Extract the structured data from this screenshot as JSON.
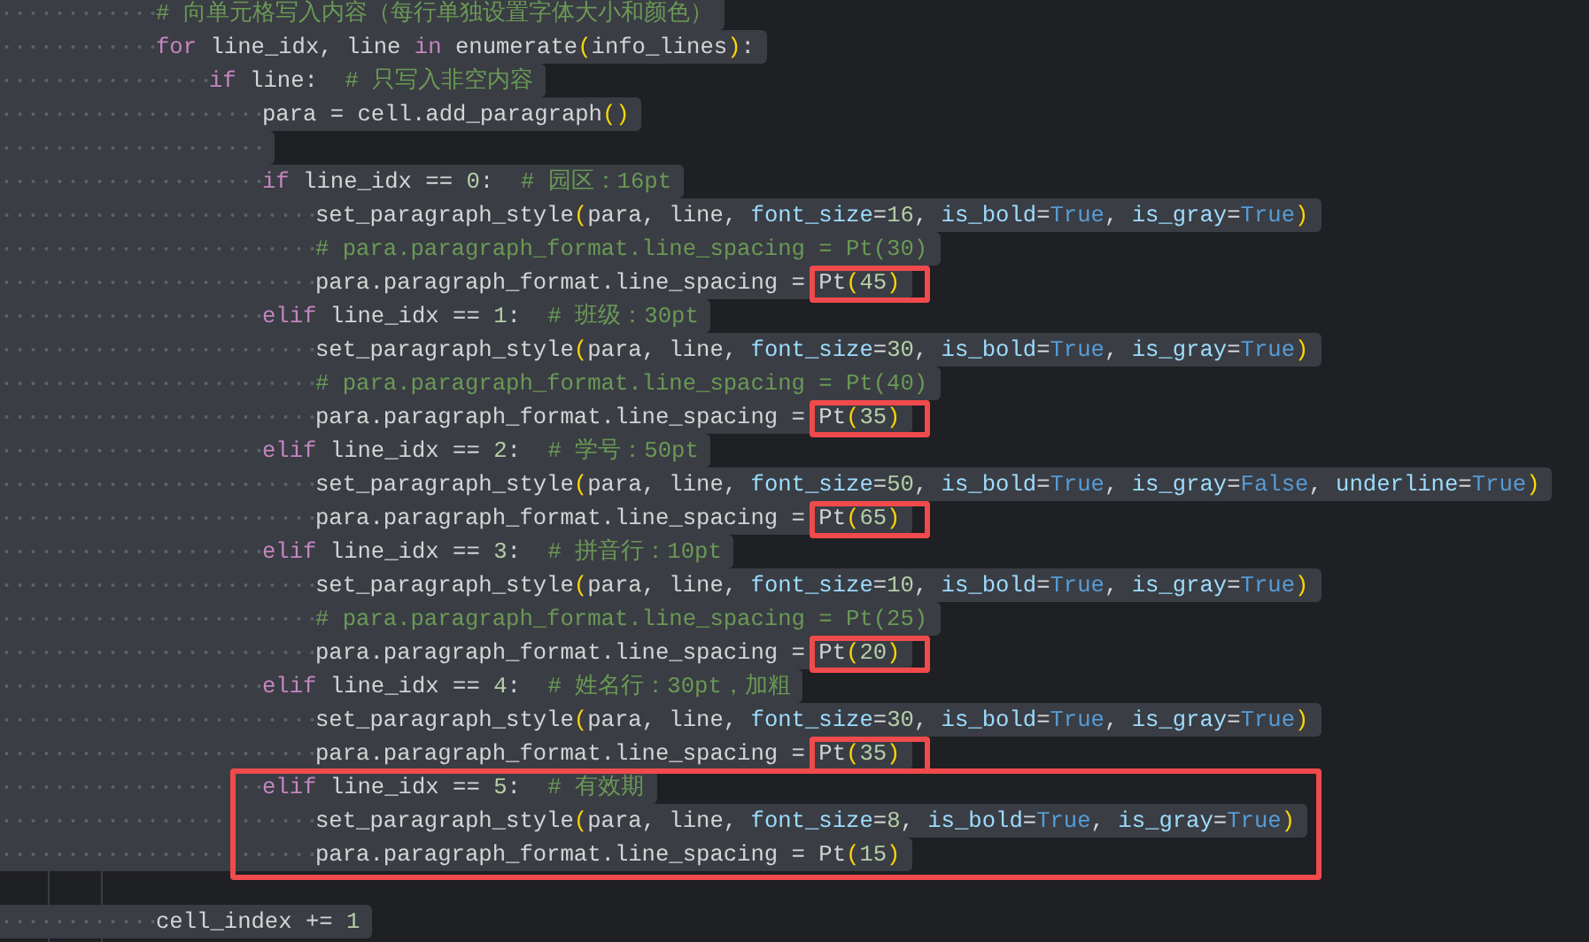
{
  "lines": [
    {
      "selected": true,
      "tokens": [
        {
          "kind": "cmt",
          "text": "# 向单元格写入内容（每行单独设置字体大小和颜色）"
        }
      ]
    },
    {
      "selected": true,
      "tokens": [
        {
          "kind": "kw",
          "text": "for"
        },
        {
          "kind": "id",
          "text": " line_idx, line "
        },
        {
          "kind": "kw",
          "text": "in"
        },
        {
          "kind": "id",
          "text": " enumerate"
        },
        {
          "kind": "paren",
          "text": "("
        },
        {
          "kind": "id",
          "text": "info_lines"
        },
        {
          "kind": "paren",
          "text": ")"
        },
        {
          "kind": "id",
          "text": ":"
        }
      ],
      "children": [
        {
          "selected": true,
          "tokens": [
            {
              "kind": "kw",
              "text": "if"
            },
            {
              "kind": "id",
              "text": " line:  "
            },
            {
              "kind": "cmt",
              "text": "# 只写入非空内容"
            }
          ],
          "children": [
            {
              "selected": true,
              "tokens": [
                {
                  "kind": "id",
                  "text": "para = cell.add_paragraph"
                },
                {
                  "kind": "paren",
                  "text": "()"
                }
              ]
            },
            {
              "selected": true
            },
            {
              "selected": true,
              "tokens": [
                {
                  "kind": "kw",
                  "text": "if"
                },
                {
                  "kind": "id",
                  "text": " line_idx == "
                },
                {
                  "kind": "num",
                  "text": "0"
                },
                {
                  "kind": "id",
                  "text": ":  "
                },
                {
                  "kind": "cmt",
                  "text": "# 园区：16pt"
                }
              ],
              "children": [
                {
                  "selected": true,
                  "tokens": [
                    {
                      "kind": "id",
                      "text": "set_paragraph_style"
                    },
                    {
                      "kind": "paren",
                      "text": "("
                    },
                    {
                      "kind": "id",
                      "text": "para, line, "
                    },
                    {
                      "kind": "param",
                      "text": "font_size"
                    },
                    {
                      "kind": "id",
                      "text": "="
                    },
                    {
                      "kind": "num",
                      "text": "16"
                    },
                    {
                      "kind": "id",
                      "text": ", "
                    },
                    {
                      "kind": "param",
                      "text": "is_bold"
                    },
                    {
                      "kind": "id",
                      "text": "="
                    },
                    {
                      "kind": "const",
                      "text": "True"
                    },
                    {
                      "kind": "id",
                      "text": ", "
                    },
                    {
                      "kind": "param",
                      "text": "is_gray"
                    },
                    {
                      "kind": "id",
                      "text": "="
                    },
                    {
                      "kind": "const",
                      "text": "True"
                    },
                    {
                      "kind": "paren",
                      "text": ")"
                    }
                  ]
                },
                {
                  "selected": true,
                  "tokens": [
                    {
                      "kind": "cmt",
                      "text": "# para.paragraph_format.line_spacing = Pt(30)"
                    }
                  ]
                },
                {
                  "selected": true,
                  "tokens": [
                    {
                      "kind": "id",
                      "text": "para.paragraph_format.line_spacing = "
                    },
                    {
                      "kind": "group",
                      "framed": true,
                      "tokens": [
                        {
                          "kind": "id",
                          "text": "Pt"
                        },
                        {
                          "kind": "paren",
                          "text": "("
                        },
                        {
                          "kind": "num",
                          "text": "45"
                        },
                        {
                          "kind": "paren",
                          "text": ")"
                        }
                      ]
                    }
                  ]
                }
              ]
            },
            {
              "selected": true,
              "tokens": [
                {
                  "kind": "kw",
                  "text": "elif"
                },
                {
                  "kind": "id",
                  "text": " line_idx == "
                },
                {
                  "kind": "num",
                  "text": "1"
                },
                {
                  "kind": "id",
                  "text": ":  "
                },
                {
                  "kind": "cmt",
                  "text": "# 班级：30pt"
                }
              ],
              "children": [
                {
                  "selected": true,
                  "tokens": [
                    {
                      "kind": "id",
                      "text": "set_paragraph_style"
                    },
                    {
                      "kind": "paren",
                      "text": "("
                    },
                    {
                      "kind": "id",
                      "text": "para, line, "
                    },
                    {
                      "kind": "param",
                      "text": "font_size"
                    },
                    {
                      "kind": "id",
                      "text": "="
                    },
                    {
                      "kind": "num",
                      "text": "30"
                    },
                    {
                      "kind": "id",
                      "text": ", "
                    },
                    {
                      "kind": "param",
                      "text": "is_bold"
                    },
                    {
                      "kind": "id",
                      "text": "="
                    },
                    {
                      "kind": "const",
                      "text": "True"
                    },
                    {
                      "kind": "id",
                      "text": ", "
                    },
                    {
                      "kind": "param",
                      "text": "is_gray"
                    },
                    {
                      "kind": "id",
                      "text": "="
                    },
                    {
                      "kind": "const",
                      "text": "True"
                    },
                    {
                      "kind": "paren",
                      "text": ")"
                    }
                  ]
                },
                {
                  "selected": true,
                  "tokens": [
                    {
                      "kind": "cmt",
                      "text": "# para.paragraph_format.line_spacing = Pt(40)"
                    }
                  ]
                },
                {
                  "selected": true,
                  "tokens": [
                    {
                      "kind": "id",
                      "text": "para.paragraph_format.line_spacing = "
                    },
                    {
                      "kind": "group",
                      "framed": true,
                      "tokens": [
                        {
                          "kind": "id",
                          "text": "Pt"
                        },
                        {
                          "kind": "paren",
                          "text": "("
                        },
                        {
                          "kind": "num",
                          "text": "35"
                        },
                        {
                          "kind": "paren",
                          "text": ")"
                        }
                      ]
                    }
                  ]
                }
              ]
            },
            {
              "selected": true,
              "tokens": [
                {
                  "kind": "kw",
                  "text": "elif"
                },
                {
                  "kind": "id",
                  "text": " line_idx == "
                },
                {
                  "kind": "num",
                  "text": "2"
                },
                {
                  "kind": "id",
                  "text": ":  "
                },
                {
                  "kind": "cmt",
                  "text": "# 学号：50pt"
                }
              ],
              "children": [
                {
                  "selected": true,
                  "tokens": [
                    {
                      "kind": "id",
                      "text": "set_paragraph_style"
                    },
                    {
                      "kind": "paren",
                      "text": "("
                    },
                    {
                      "kind": "id",
                      "text": "para, line, "
                    },
                    {
                      "kind": "param",
                      "text": "font_size"
                    },
                    {
                      "kind": "id",
                      "text": "="
                    },
                    {
                      "kind": "num",
                      "text": "50"
                    },
                    {
                      "kind": "id",
                      "text": ", "
                    },
                    {
                      "kind": "param",
                      "text": "is_bold"
                    },
                    {
                      "kind": "id",
                      "text": "="
                    },
                    {
                      "kind": "const",
                      "text": "True"
                    },
                    {
                      "kind": "id",
                      "text": ", "
                    },
                    {
                      "kind": "param",
                      "text": "is_gray"
                    },
                    {
                      "kind": "id",
                      "text": "="
                    },
                    {
                      "kind": "const",
                      "text": "False"
                    },
                    {
                      "kind": "id",
                      "text": ", "
                    },
                    {
                      "kind": "param",
                      "text": "underline"
                    },
                    {
                      "kind": "id",
                      "text": "="
                    },
                    {
                      "kind": "const",
                      "text": "True"
                    },
                    {
                      "kind": "paren",
                      "text": ")"
                    }
                  ]
                },
                {
                  "selected": true,
                  "tokens": [
                    {
                      "kind": "id",
                      "text": "para.paragraph_format.line_spacing = "
                    },
                    {
                      "kind": "group",
                      "framed": true,
                      "tokens": [
                        {
                          "kind": "id",
                          "text": "Pt"
                        },
                        {
                          "kind": "paren",
                          "text": "("
                        },
                        {
                          "kind": "num",
                          "text": "65"
                        },
                        {
                          "kind": "paren",
                          "text": ")"
                        }
                      ]
                    }
                  ]
                }
              ]
            },
            {
              "selected": true,
              "tokens": [
                {
                  "kind": "kw",
                  "text": "elif"
                },
                {
                  "kind": "id",
                  "text": " line_idx == "
                },
                {
                  "kind": "num",
                  "text": "3"
                },
                {
                  "kind": "id",
                  "text": ":  "
                },
                {
                  "kind": "cmt",
                  "text": "# 拼音行：10pt"
                }
              ],
              "children": [
                {
                  "selected": true,
                  "tokens": [
                    {
                      "kind": "id",
                      "text": "set_paragraph_style"
                    },
                    {
                      "kind": "paren",
                      "text": "("
                    },
                    {
                      "kind": "id",
                      "text": "para, line, "
                    },
                    {
                      "kind": "param",
                      "text": "font_size"
                    },
                    {
                      "kind": "id",
                      "text": "="
                    },
                    {
                      "kind": "num",
                      "text": "10"
                    },
                    {
                      "kind": "id",
                      "text": ", "
                    },
                    {
                      "kind": "param",
                      "text": "is_bold"
                    },
                    {
                      "kind": "id",
                      "text": "="
                    },
                    {
                      "kind": "const",
                      "text": "True"
                    },
                    {
                      "kind": "id",
                      "text": ", "
                    },
                    {
                      "kind": "param",
                      "text": "is_gray"
                    },
                    {
                      "kind": "id",
                      "text": "="
                    },
                    {
                      "kind": "const",
                      "text": "True"
                    },
                    {
                      "kind": "paren",
                      "text": ")"
                    }
                  ]
                },
                {
                  "selected": true,
                  "tokens": [
                    {
                      "kind": "cmt",
                      "text": "# para.paragraph_format.line_spacing = Pt(25)"
                    }
                  ]
                },
                {
                  "selected": true,
                  "tokens": [
                    {
                      "kind": "id",
                      "text": "para.paragraph_format.line_spacing = "
                    },
                    {
                      "kind": "group",
                      "framed": true,
                      "tokens": [
                        {
                          "kind": "id",
                          "text": "Pt"
                        },
                        {
                          "kind": "paren",
                          "text": "("
                        },
                        {
                          "kind": "num",
                          "text": "20"
                        },
                        {
                          "kind": "paren",
                          "text": ")"
                        }
                      ]
                    }
                  ]
                }
              ]
            },
            {
              "selected": true,
              "tokens": [
                {
                  "kind": "kw",
                  "text": "elif"
                },
                {
                  "kind": "id",
                  "text": " line_idx == "
                },
                {
                  "kind": "num",
                  "text": "4"
                },
                {
                  "kind": "id",
                  "text": ":  "
                },
                {
                  "kind": "cmt",
                  "text": "# 姓名行：30pt，加粗"
                }
              ],
              "children": [
                {
                  "selected": true,
                  "tokens": [
                    {
                      "kind": "id",
                      "text": "set_paragraph_style"
                    },
                    {
                      "kind": "paren",
                      "text": "("
                    },
                    {
                      "kind": "id",
                      "text": "para, line, "
                    },
                    {
                      "kind": "param",
                      "text": "font_size"
                    },
                    {
                      "kind": "id",
                      "text": "="
                    },
                    {
                      "kind": "num",
                      "text": "30"
                    },
                    {
                      "kind": "id",
                      "text": ", "
                    },
                    {
                      "kind": "param",
                      "text": "is_bold"
                    },
                    {
                      "kind": "id",
                      "text": "="
                    },
                    {
                      "kind": "const",
                      "text": "True"
                    },
                    {
                      "kind": "id",
                      "text": ", "
                    },
                    {
                      "kind": "param",
                      "text": "is_gray"
                    },
                    {
                      "kind": "id",
                      "text": "="
                    },
                    {
                      "kind": "const",
                      "text": "True"
                    },
                    {
                      "kind": "paren",
                      "text": ")"
                    }
                  ]
                },
                {
                  "selected": true,
                  "tokens": [
                    {
                      "kind": "id",
                      "text": "para.paragraph_format.line_spacing = "
                    },
                    {
                      "kind": "group",
                      "framed": true,
                      "tokens": [
                        {
                          "kind": "id",
                          "text": "Pt"
                        },
                        {
                          "kind": "paren",
                          "text": "("
                        },
                        {
                          "kind": "num",
                          "text": "35"
                        },
                        {
                          "kind": "paren",
                          "text": ")"
                        }
                      ]
                    }
                  ]
                }
              ]
            },
            {
              "selected": true,
              "framed": true,
              "tokens": [
                {
                  "kind": "kw",
                  "text": "elif"
                },
                {
                  "kind": "id",
                  "text": " line_idx == "
                },
                {
                  "kind": "num",
                  "text": "5"
                },
                {
                  "kind": "id",
                  "text": ":  "
                },
                {
                  "kind": "cmt",
                  "text": "# 有效期"
                }
              ],
              "children": [
                {
                  "selected": true,
                  "tokens": [
                    {
                      "kind": "id",
                      "text": "set_paragraph_style"
                    },
                    {
                      "kind": "paren",
                      "text": "("
                    },
                    {
                      "kind": "id",
                      "text": "para, line, "
                    },
                    {
                      "kind": "param",
                      "text": "font_size"
                    },
                    {
                      "kind": "id",
                      "text": "="
                    },
                    {
                      "kind": "num",
                      "text": "8"
                    },
                    {
                      "kind": "id",
                      "text": ", "
                    },
                    {
                      "kind": "param",
                      "text": "is_bold"
                    },
                    {
                      "kind": "id",
                      "text": "="
                    },
                    {
                      "kind": "const",
                      "text": "True"
                    },
                    {
                      "kind": "id",
                      "text": ", "
                    },
                    {
                      "kind": "param",
                      "text": "is_gray"
                    },
                    {
                      "kind": "id",
                      "text": "="
                    },
                    {
                      "kind": "const",
                      "text": "True"
                    },
                    {
                      "kind": "paren",
                      "text": ")"
                    }
                  ]
                },
                {
                  "selected": true,
                  "tokens": [
                    {
                      "kind": "id",
                      "text": "para.paragraph_format.line_spacing = "
                    },
                    {
                      "kind": "group",
                      "tokens": [
                        {
                          "kind": "id",
                          "text": "Pt"
                        },
                        {
                          "kind": "paren",
                          "text": "("
                        },
                        {
                          "kind": "num",
                          "text": "15"
                        },
                        {
                          "kind": "paren",
                          "text": ")"
                        }
                      ]
                    }
                  ]
                }
              ]
            }
          ]
        }
      ]
    },
    {
      "selected": false
    },
    {
      "selected": true,
      "tokens": [
        {
          "kind": "id",
          "text": "cell_index "
        },
        {
          "kind": "op",
          "text": "+= "
        },
        {
          "kind": "num",
          "text": "1"
        }
      ]
    }
  ]
}
